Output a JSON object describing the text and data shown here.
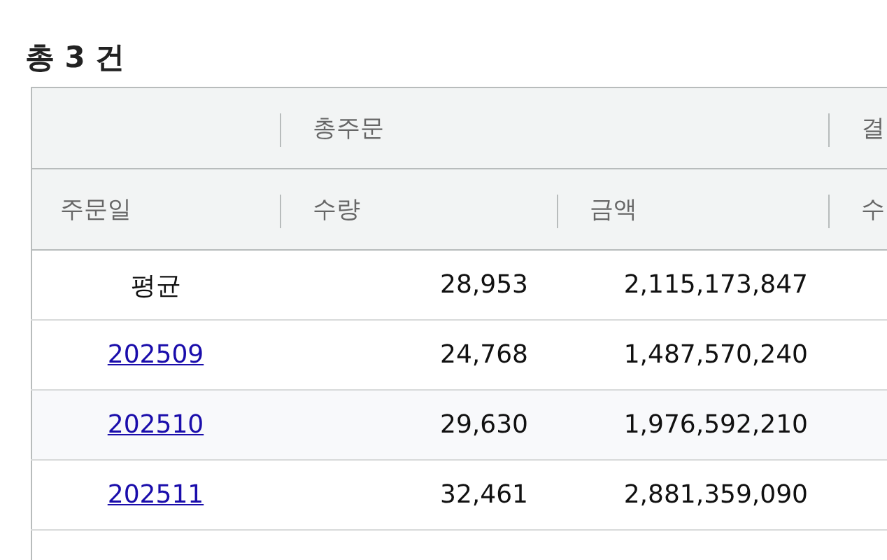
{
  "title": "총 3 건",
  "table": {
    "group_headers": [
      {
        "label": "총주문"
      },
      {
        "label": "결"
      }
    ],
    "columns": [
      "주문일",
      "수량",
      "금액",
      "수"
    ],
    "rows": [
      {
        "kind": "summary",
        "date": "평균",
        "quantity": "28,953",
        "amount": "2,115,173,847"
      },
      {
        "kind": "link",
        "date": "202509",
        "quantity": "24,768",
        "amount": "1,487,570,240"
      },
      {
        "kind": "link",
        "date": "202510",
        "quantity": "29,630",
        "amount": "1,976,592,210"
      },
      {
        "kind": "link",
        "date": "202511",
        "quantity": "32,461",
        "amount": "2,881,359,090"
      }
    ]
  }
}
